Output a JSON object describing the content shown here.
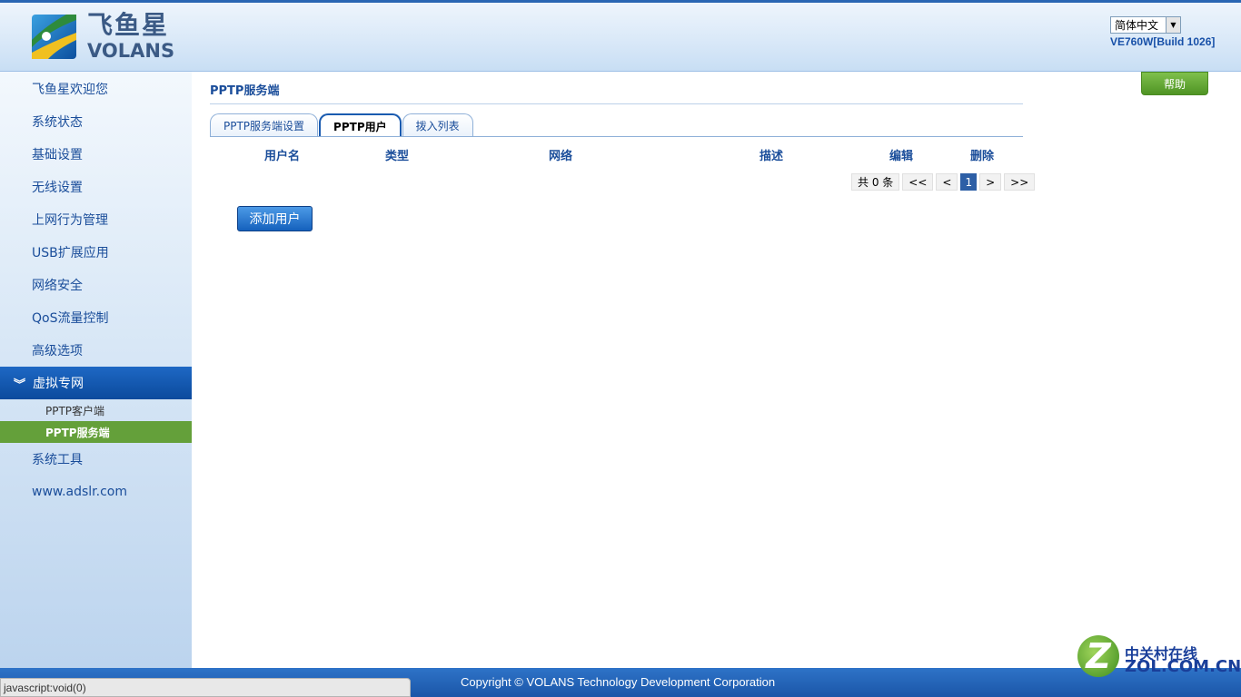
{
  "header": {
    "logo_cn": "飞鱼星",
    "logo_en": "VOLANS",
    "language": "简体中文",
    "version": "VE760W[Build 1026]"
  },
  "sidebar": {
    "items": [
      {
        "label": "飞鱼星欢迎您"
      },
      {
        "label": "系统状态"
      },
      {
        "label": "基础设置"
      },
      {
        "label": "无线设置"
      },
      {
        "label": "上网行为管理"
      },
      {
        "label": "USB扩展应用"
      },
      {
        "label": "网络安全"
      },
      {
        "label": "QoS流量控制"
      },
      {
        "label": "高级选项"
      },
      {
        "label": "虚拟专网"
      },
      {
        "label": "系统工具"
      },
      {
        "label": "www.adslr.com"
      }
    ],
    "sub_items": [
      {
        "label": "PPTP客户端"
      },
      {
        "label": "PPTP服务端"
      }
    ]
  },
  "main": {
    "title": "PPTP服务端",
    "help_label": "帮助",
    "tabs": [
      {
        "label": "PPTP服务端设置"
      },
      {
        "label": "PPTP用户"
      },
      {
        "label": "拨入列表"
      }
    ],
    "columns": [
      "用户名",
      "类型",
      "网络",
      "描述",
      "编辑",
      "删除"
    ],
    "pager": {
      "total": "共 0 条",
      "first": "<<",
      "prev": "<",
      "current": "1",
      "next": ">",
      "last": ">>"
    },
    "add_button": "添加用户"
  },
  "footer": {
    "copyright": "Copyright © VOLANS Technology Development Corporation",
    "status_text": "javascript:void(0)",
    "watermark_cn": "中关村在线",
    "watermark_en": "ZOL.COM.CN"
  },
  "colors": {
    "brand_blue": "#1a4d9a",
    "active_nav": "#0b4a9d",
    "selected_sub": "#64a03a",
    "help_green": "#4f9424"
  }
}
